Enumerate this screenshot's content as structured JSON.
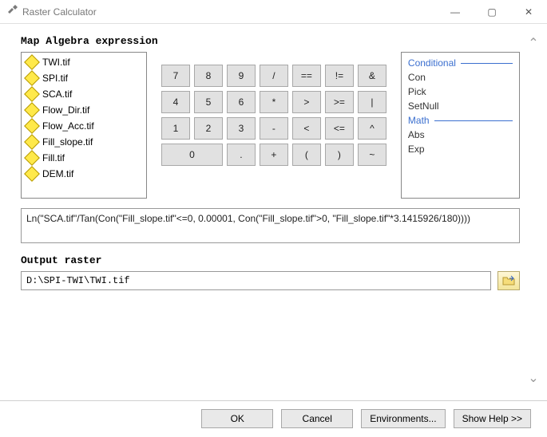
{
  "window": {
    "title": "Raster Calculator"
  },
  "labels": {
    "expr": "Map Algebra expression",
    "out": "Output raster"
  },
  "layers": [
    "TWI.tif",
    "SPI.tif",
    "SCA.tif",
    "Flow_Dir.tif",
    "Flow_Acc.tif",
    "Fill_slope.tif",
    "Fill.tif",
    "DEM.tif"
  ],
  "keypad": [
    [
      "7",
      "8",
      "9",
      "/",
      "==",
      "!=",
      "&"
    ],
    [
      "4",
      "5",
      "6",
      "*",
      ">",
      ">=",
      "|"
    ],
    [
      "1",
      "2",
      "3",
      "-",
      "<",
      "<=",
      "^"
    ],
    [
      "0",
      ".",
      "+",
      "(",
      ")",
      "~"
    ]
  ],
  "func_groups": [
    {
      "title": "Conditional",
      "items": [
        "Con",
        "Pick",
        "SetNull"
      ]
    },
    {
      "title": "Math",
      "items": [
        "Abs",
        "Exp"
      ]
    }
  ],
  "expression": "Ln(\"SCA.tif\"/Tan(Con(\"Fill_slope.tif\"<=0, 0.00001, Con(\"Fill_slope.tif\">0, \"Fill_slope.tif\"*3.1415926/180))))",
  "output_path": "D:\\SPI-TWI\\TWI.tif",
  "buttons": {
    "ok": "OK",
    "cancel": "Cancel",
    "env": "Environments...",
    "help": "Show Help >>"
  }
}
